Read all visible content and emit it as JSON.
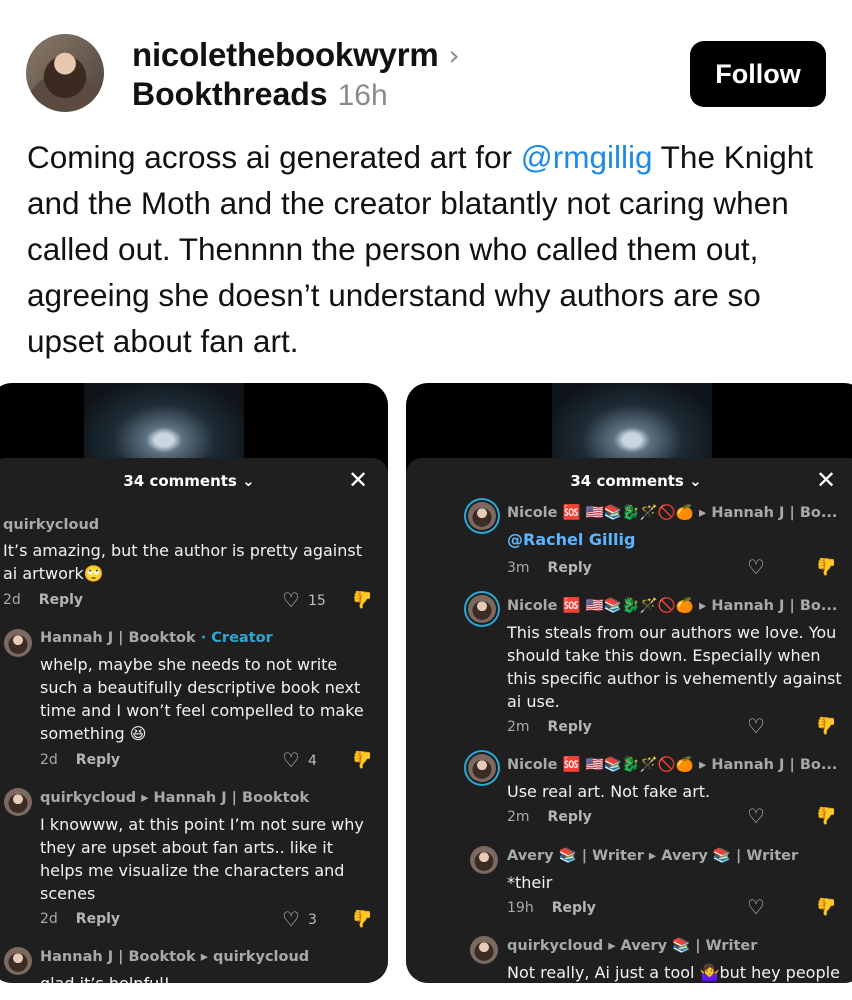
{
  "post": {
    "username": "nicolethebookwyrm",
    "community": "Bookthreads",
    "time": "16h",
    "follow_label": "Follow",
    "text_before": "Coming across ai generated art for ",
    "mention": "@rmgillig",
    "text_after": " The Knight and the Moth and the creator blatantly not caring when called out. Thennnn the person who called them out, agreeing she doesn’t understand why authors are so upset about fan art."
  },
  "left_panel": {
    "title": "34 comments ⌄",
    "close": "✕",
    "comments": [
      {
        "name": "quirkycloud",
        "body": "It’s amazing, but the author is pretty against ai artwork🙄",
        "age": "2d",
        "reply": "Reply",
        "likes": "15"
      },
      {
        "name": "Hannah J | Booktok",
        "creator": "· Creator",
        "body": "whelp, maybe she needs to not write such a beautifully descriptive book next time and I won’t feel compelled to make something 😆",
        "age": "2d",
        "reply": "Reply",
        "likes": "4"
      },
      {
        "name": "quirkycloud ▸ Hannah J | Booktok",
        "body": "I knowww, at this point I’m not sure why they are upset about fan arts.. like it helps me visualize the characters and scenes",
        "age": "2d",
        "reply": "Reply",
        "likes": "3"
      },
      {
        "name": "Hannah J | Booktok ▸ quirkycloud",
        "body": "glad it’s helpful!"
      }
    ]
  },
  "right_panel": {
    "title": "34 comments ⌄",
    "close": "✕",
    "comments": [
      {
        "name": "Nicole 🆘 🇺🇸📚🐉🪄🚫🍊 ▸ Hannah J | Bo...",
        "body": "@Rachel Gillig",
        "age": "3m",
        "reply": "Reply"
      },
      {
        "name": "Nicole 🆘 🇺🇸📚🐉🪄🚫🍊 ▸ Hannah J | Bo...",
        "body": "This steals from our authors we love. You should take this down. Especially when this specific author is vehemently against ai use.",
        "age": "2m",
        "reply": "Reply"
      },
      {
        "name": "Nicole 🆘 🇺🇸📚🐉🪄🚫🍊 ▸ Hannah J | Bo...",
        "body": "Use real art. Not fake art.",
        "age": "2m",
        "reply": "Reply"
      },
      {
        "name": "Avery 📚 | Writer ▸ Avery 📚 | Writer",
        "body": "*their",
        "age": "19h",
        "reply": "Reply"
      },
      {
        "name": "quirkycloud ▸ Avery 📚 | Writer",
        "body": "Not really, Ai just a tool 🤷‍♀️but hey people"
      }
    ]
  },
  "icons": {
    "heart": "heart-icon",
    "dislike": "thumbs-down-icon",
    "close": "close-icon",
    "chevron": "chevron-right-icon"
  }
}
